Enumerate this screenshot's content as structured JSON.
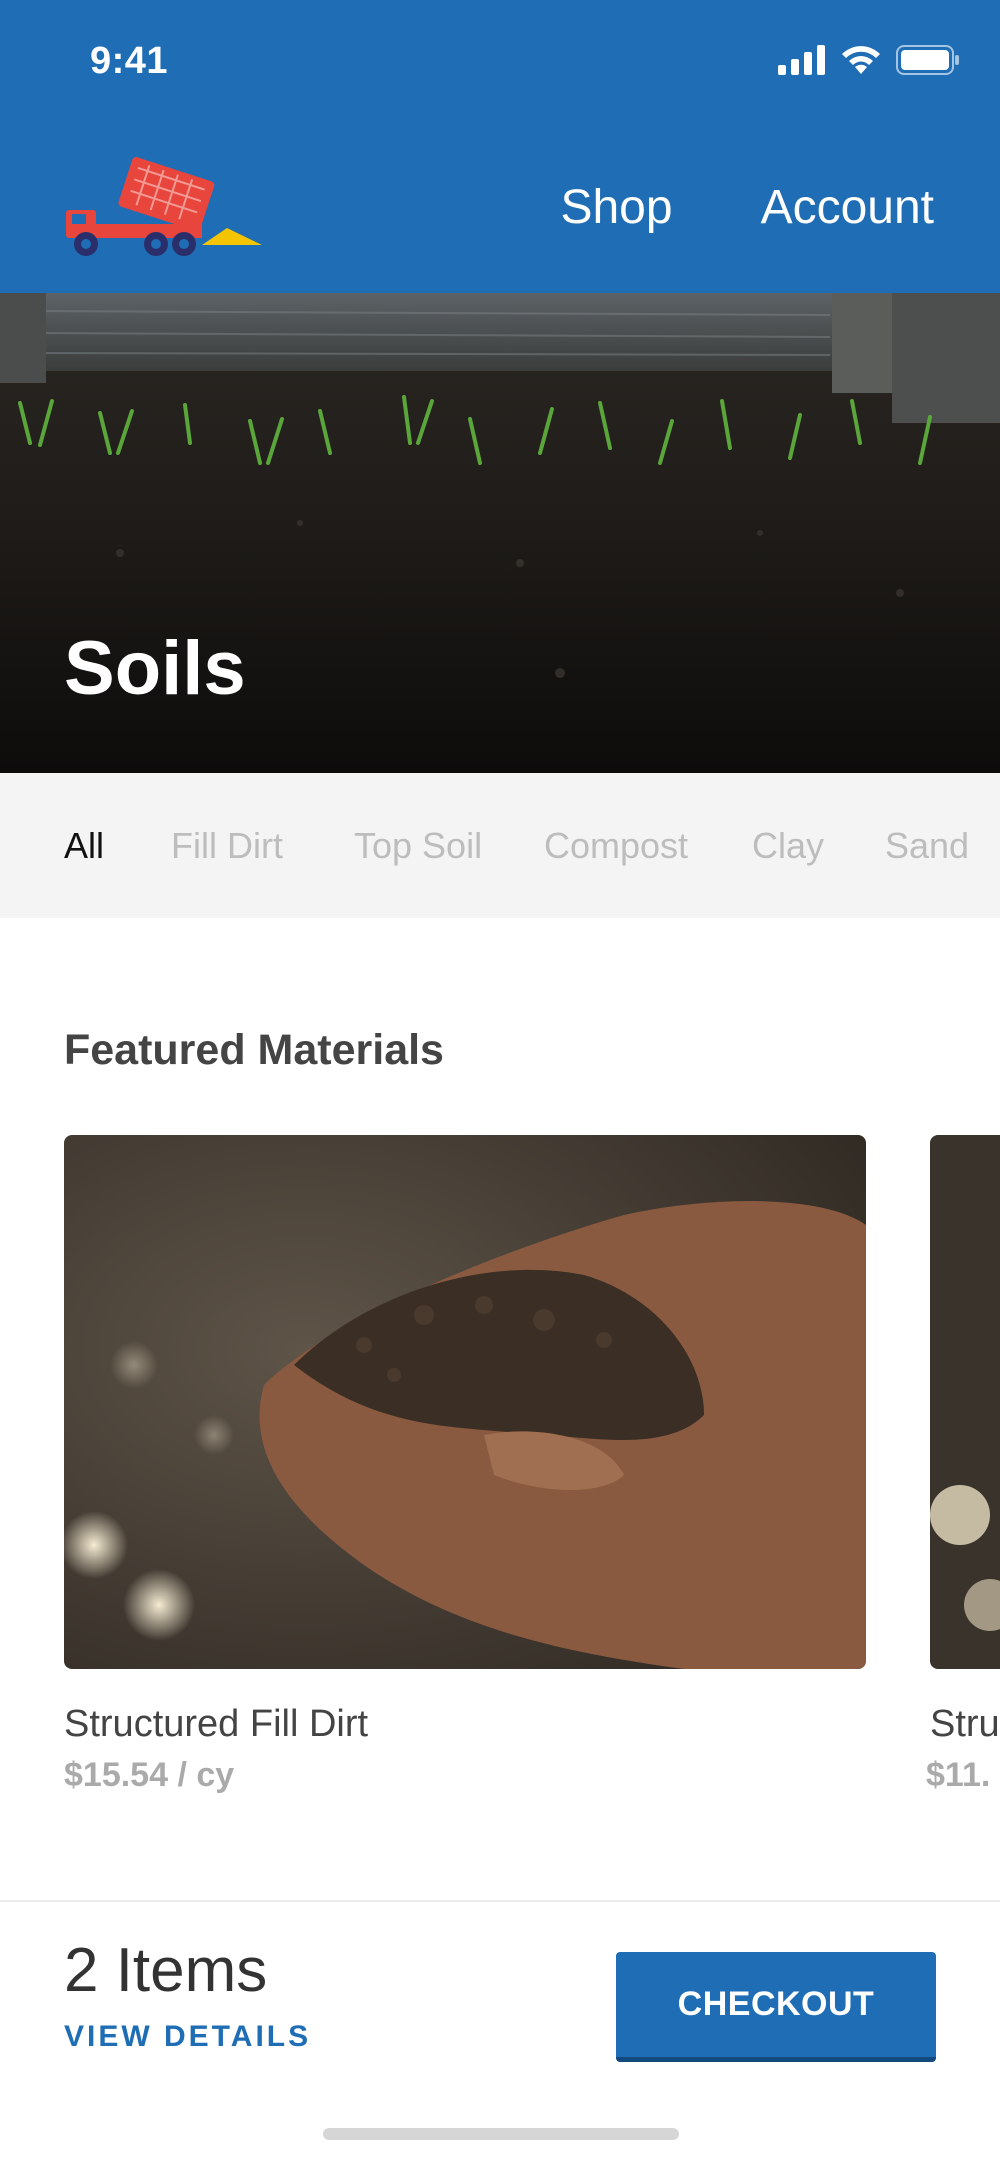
{
  "status": {
    "time": "9:41"
  },
  "nav": {
    "shop": "Shop",
    "account": "Account"
  },
  "hero": {
    "title": "Soils"
  },
  "categories": [
    "All",
    "Fill Dirt",
    "Top Soil",
    "Compost",
    "Clay",
    "Sand"
  ],
  "featured": {
    "title": "Featured Materials",
    "items": [
      {
        "name": "Structured Fill Dirt",
        "price": "$15.54 / cy"
      },
      {
        "name": "Stru",
        "price": "$11."
      }
    ]
  },
  "cart": {
    "count": "2 Items",
    "details_label": "VIEW DETAILS",
    "checkout_label": "CHECKOUT"
  },
  "colors": {
    "brand": "#1f6db5",
    "truck": "#e8453c",
    "sand": "#f4c400"
  }
}
